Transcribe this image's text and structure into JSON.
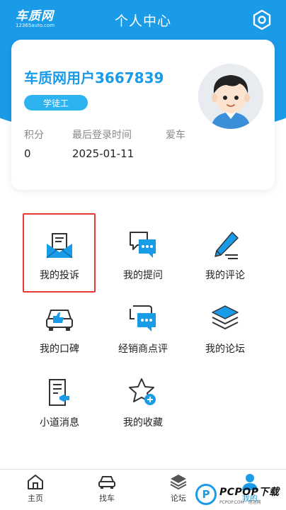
{
  "header": {
    "logo_main": "车质网",
    "logo_sub": "12365auto.com",
    "title": "个人中心"
  },
  "profile": {
    "username": "车质网用户3667839",
    "level": "学徒工",
    "stats": [
      {
        "label": "积分",
        "value": "0"
      },
      {
        "label": "最后登录时间",
        "value": "2025-01-11"
      },
      {
        "label": "爱车",
        "value": ""
      }
    ]
  },
  "menu": [
    {
      "label": "我的投诉",
      "icon": "complaint-envelope-icon"
    },
    {
      "label": "我的提问",
      "icon": "question-chat-icon"
    },
    {
      "label": "我的评论",
      "icon": "comment-pen-icon"
    },
    {
      "label": "我的口碑",
      "icon": "car-thumbs-up-icon"
    },
    {
      "label": "经销商点评",
      "icon": "dealer-review-icon"
    },
    {
      "label": "我的论坛",
      "icon": "forum-layers-icon"
    },
    {
      "label": "小道消息",
      "icon": "news-document-icon"
    },
    {
      "label": "我的收藏",
      "icon": "favorite-star-icon"
    }
  ],
  "bottom_nav": [
    {
      "label": "主页",
      "icon": "home-icon"
    },
    {
      "label": "找车",
      "icon": "car-icon"
    },
    {
      "label": "论坛",
      "icon": "layers-icon"
    },
    {
      "label": "我的",
      "icon": "user-icon"
    }
  ],
  "watermark": {
    "letter": "P",
    "main": "PCPOP下载",
    "sub": "PCPOP.COM · 泡泡网"
  },
  "colors": {
    "accent": "#1a9be8",
    "badge": "#2db4f0",
    "highlight": "#e53935"
  }
}
